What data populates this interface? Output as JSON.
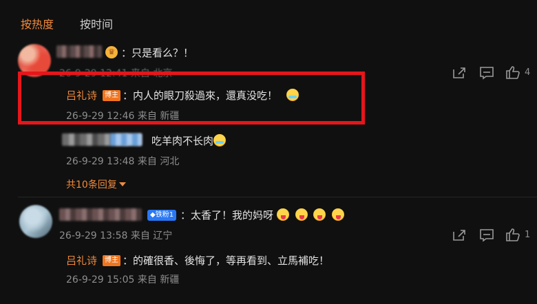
{
  "tabs": [
    {
      "label": "按热度",
      "active": true
    },
    {
      "label": "按时间",
      "active": false
    }
  ],
  "comments": [
    {
      "text": "：只是看么？！",
      "meta_time": "26-9-29 12:41",
      "meta_from": "来自 北京",
      "like_count": "4",
      "replies": [
        {
          "author": "吕礼诗",
          "badge": "博主",
          "text": "：内人的眼刀殺過來，還真没吃！",
          "emoji": "cry-laugh",
          "time": "26-9-29 12:46",
          "from": "来自 新疆"
        },
        {
          "text": "吃羊肉不长肉",
          "emoji": "cry-laugh",
          "time": "26-9-29 13:48",
          "from": "来自 河北"
        }
      ],
      "more_replies": "共10条回复"
    },
    {
      "fan_badge": "铁粉1",
      "text": "：太香了！我的妈呀",
      "emojis": [
        "tongue",
        "tongue",
        "tongue",
        "tongue"
      ],
      "meta_time": "26-9-29 13:58",
      "meta_from": "来自 辽宁",
      "like_count": "1",
      "replies": [
        {
          "author": "吕礼诗",
          "badge": "博主",
          "text": "：的確很香、後悔了，等再看到、立馬補吃！",
          "time": "26-9-29 15:05",
          "from": "来自 新疆"
        }
      ]
    }
  ],
  "icons": [
    "share-icon",
    "comment-icon",
    "like-icon"
  ],
  "colors": {
    "accent": "#f08a3c",
    "highlight": "#e6161b",
    "host_badge": "#f1751f",
    "fan_badge": "#2a78f4"
  }
}
